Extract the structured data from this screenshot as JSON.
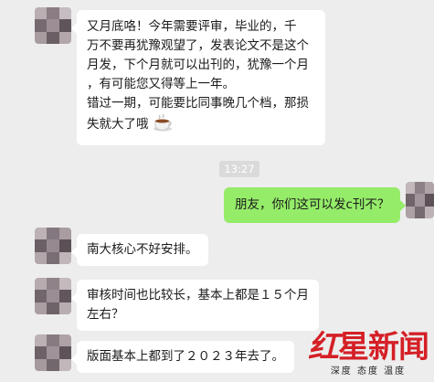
{
  "chat": {
    "messages": [
      {
        "sender": "other",
        "lines": [
          "又月底咯！今年需要评审，毕业的，千",
          "万不要再犹豫观望了，发表论文不是这个",
          "月发，下个月就可以出刊的，犹豫一个月",
          "，有可能您又得等上一年。",
          "错过一期，可能要比同事晚几个档，那损",
          "失就大了哦"
        ],
        "emoji": "coffee-cup-icon"
      },
      {
        "sender": "time",
        "text": "13:27"
      },
      {
        "sender": "me",
        "lines": [
          "朋友，你们这可以发c刊不？"
        ]
      },
      {
        "sender": "other",
        "lines": [
          "南大核心不好安排。"
        ]
      },
      {
        "sender": "other",
        "lines": [
          "审核时间也比较长，基本上都是１５个月",
          "左右？"
        ]
      },
      {
        "sender": "other",
        "lines": [
          "版面基本上都到了２０２３年去了。"
        ]
      }
    ]
  },
  "watermark": {
    "brand_part1": "红",
    "brand_part2": "星新闻",
    "tagline": "深度 态度 温度"
  },
  "colors": {
    "background": "#ededed",
    "bubble_other": "#ffffff",
    "bubble_me": "#95ec69",
    "brand_red": "#d51f26"
  }
}
